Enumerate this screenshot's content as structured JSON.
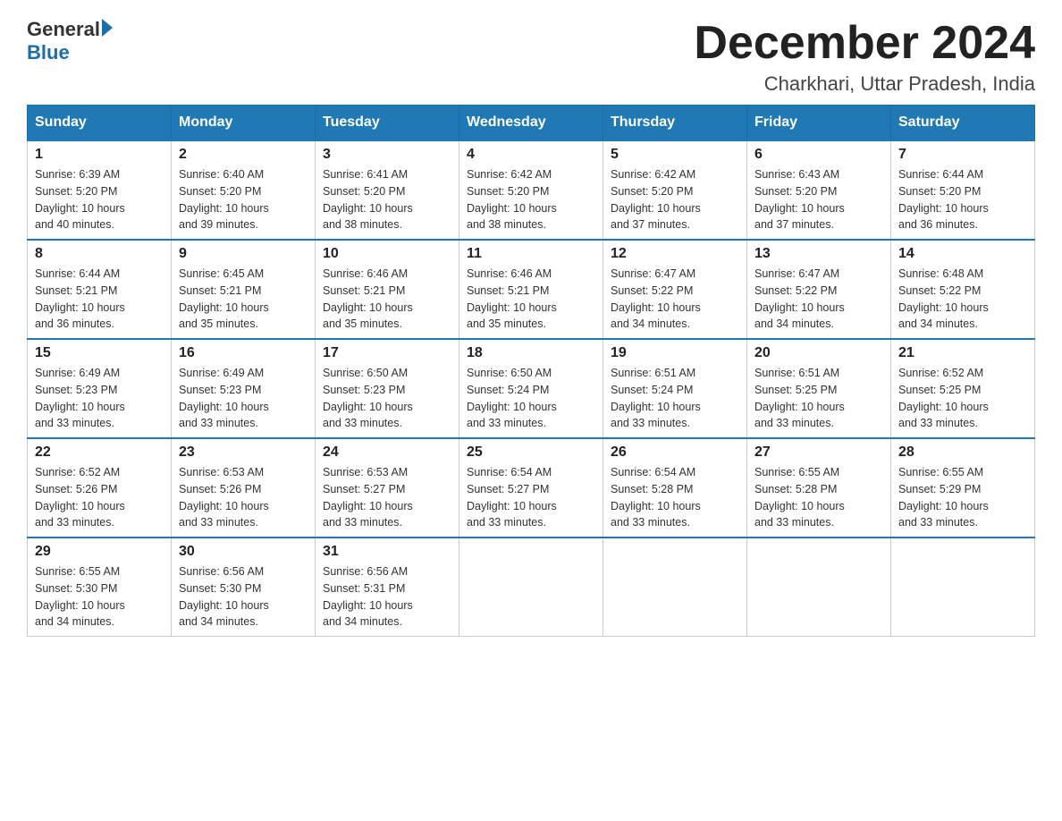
{
  "header": {
    "logo_general": "General",
    "logo_blue": "Blue",
    "month_title": "December 2024",
    "location": "Charkhari, Uttar Pradesh, India"
  },
  "days_of_week": [
    "Sunday",
    "Monday",
    "Tuesday",
    "Wednesday",
    "Thursday",
    "Friday",
    "Saturday"
  ],
  "weeks": [
    [
      {
        "day": "1",
        "sunrise": "6:39 AM",
        "sunset": "5:20 PM",
        "daylight": "10 hours and 40 minutes."
      },
      {
        "day": "2",
        "sunrise": "6:40 AM",
        "sunset": "5:20 PM",
        "daylight": "10 hours and 39 minutes."
      },
      {
        "day": "3",
        "sunrise": "6:41 AM",
        "sunset": "5:20 PM",
        "daylight": "10 hours and 38 minutes."
      },
      {
        "day": "4",
        "sunrise": "6:42 AM",
        "sunset": "5:20 PM",
        "daylight": "10 hours and 38 minutes."
      },
      {
        "day": "5",
        "sunrise": "6:42 AM",
        "sunset": "5:20 PM",
        "daylight": "10 hours and 37 minutes."
      },
      {
        "day": "6",
        "sunrise": "6:43 AM",
        "sunset": "5:20 PM",
        "daylight": "10 hours and 37 minutes."
      },
      {
        "day": "7",
        "sunrise": "6:44 AM",
        "sunset": "5:20 PM",
        "daylight": "10 hours and 36 minutes."
      }
    ],
    [
      {
        "day": "8",
        "sunrise": "6:44 AM",
        "sunset": "5:21 PM",
        "daylight": "10 hours and 36 minutes."
      },
      {
        "day": "9",
        "sunrise": "6:45 AM",
        "sunset": "5:21 PM",
        "daylight": "10 hours and 35 minutes."
      },
      {
        "day": "10",
        "sunrise": "6:46 AM",
        "sunset": "5:21 PM",
        "daylight": "10 hours and 35 minutes."
      },
      {
        "day": "11",
        "sunrise": "6:46 AM",
        "sunset": "5:21 PM",
        "daylight": "10 hours and 35 minutes."
      },
      {
        "day": "12",
        "sunrise": "6:47 AM",
        "sunset": "5:22 PM",
        "daylight": "10 hours and 34 minutes."
      },
      {
        "day": "13",
        "sunrise": "6:47 AM",
        "sunset": "5:22 PM",
        "daylight": "10 hours and 34 minutes."
      },
      {
        "day": "14",
        "sunrise": "6:48 AM",
        "sunset": "5:22 PM",
        "daylight": "10 hours and 34 minutes."
      }
    ],
    [
      {
        "day": "15",
        "sunrise": "6:49 AM",
        "sunset": "5:23 PM",
        "daylight": "10 hours and 33 minutes."
      },
      {
        "day": "16",
        "sunrise": "6:49 AM",
        "sunset": "5:23 PM",
        "daylight": "10 hours and 33 minutes."
      },
      {
        "day": "17",
        "sunrise": "6:50 AM",
        "sunset": "5:23 PM",
        "daylight": "10 hours and 33 minutes."
      },
      {
        "day": "18",
        "sunrise": "6:50 AM",
        "sunset": "5:24 PM",
        "daylight": "10 hours and 33 minutes."
      },
      {
        "day": "19",
        "sunrise": "6:51 AM",
        "sunset": "5:24 PM",
        "daylight": "10 hours and 33 minutes."
      },
      {
        "day": "20",
        "sunrise": "6:51 AM",
        "sunset": "5:25 PM",
        "daylight": "10 hours and 33 minutes."
      },
      {
        "day": "21",
        "sunrise": "6:52 AM",
        "sunset": "5:25 PM",
        "daylight": "10 hours and 33 minutes."
      }
    ],
    [
      {
        "day": "22",
        "sunrise": "6:52 AM",
        "sunset": "5:26 PM",
        "daylight": "10 hours and 33 minutes."
      },
      {
        "day": "23",
        "sunrise": "6:53 AM",
        "sunset": "5:26 PM",
        "daylight": "10 hours and 33 minutes."
      },
      {
        "day": "24",
        "sunrise": "6:53 AM",
        "sunset": "5:27 PM",
        "daylight": "10 hours and 33 minutes."
      },
      {
        "day": "25",
        "sunrise": "6:54 AM",
        "sunset": "5:27 PM",
        "daylight": "10 hours and 33 minutes."
      },
      {
        "day": "26",
        "sunrise": "6:54 AM",
        "sunset": "5:28 PM",
        "daylight": "10 hours and 33 minutes."
      },
      {
        "day": "27",
        "sunrise": "6:55 AM",
        "sunset": "5:28 PM",
        "daylight": "10 hours and 33 minutes."
      },
      {
        "day": "28",
        "sunrise": "6:55 AM",
        "sunset": "5:29 PM",
        "daylight": "10 hours and 33 minutes."
      }
    ],
    [
      {
        "day": "29",
        "sunrise": "6:55 AM",
        "sunset": "5:30 PM",
        "daylight": "10 hours and 34 minutes."
      },
      {
        "day": "30",
        "sunrise": "6:56 AM",
        "sunset": "5:30 PM",
        "daylight": "10 hours and 34 minutes."
      },
      {
        "day": "31",
        "sunrise": "6:56 AM",
        "sunset": "5:31 PM",
        "daylight": "10 hours and 34 minutes."
      },
      null,
      null,
      null,
      null
    ]
  ],
  "labels": {
    "sunrise_prefix": "Sunrise: ",
    "sunset_prefix": "Sunset: ",
    "daylight_prefix": "Daylight: "
  }
}
